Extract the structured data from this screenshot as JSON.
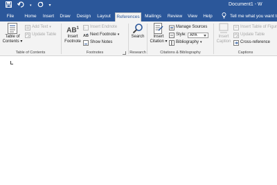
{
  "qat": {
    "save_icon": "save-icon",
    "undo_icon": "undo-icon",
    "redo_icon": "redo-icon",
    "customize_icon": "customize-qat-icon"
  },
  "title": "Document1 - W",
  "tabs": [
    "File",
    "Home",
    "Insert",
    "Draw",
    "Design",
    "Layout",
    "References",
    "Mailings",
    "Review",
    "View",
    "Help"
  ],
  "active_tab": "References",
  "tell_me": "Tell me what you want to do",
  "ribbon": {
    "toc": {
      "big_label_1": "Table of",
      "big_label_2": "Contents",
      "add_text": "Add Text",
      "update_table": "Update Table",
      "group_label": "Table of Contents"
    },
    "footnotes": {
      "big_label_1": "Insert",
      "big_label_2": "Footnote",
      "big_icon_text": "AB",
      "big_icon_sup": "1",
      "insert_endnote": "Insert Endnote",
      "next_footnote": "Next Footnote",
      "show_notes": "Show Notes",
      "group_label": "Footnotes"
    },
    "research": {
      "big_label": "Search",
      "group_label": "Research"
    },
    "citations": {
      "big_label_1": "Insert",
      "big_label_2": "Citation",
      "manage_sources": "Manage Sources",
      "style_label": "Style:",
      "style_value": "APA",
      "bibliography": "Bibliography",
      "group_label": "Citations & Bibliography"
    },
    "captions": {
      "big_label_1": "Insert",
      "big_label_2": "Caption",
      "insert_table_of_figures": "Insert Table of Figures",
      "update_table": "Update Table",
      "cross_reference": "Cross-reference",
      "group_label": "Captions"
    }
  },
  "colors": {
    "title_bar": "#2b579a",
    "ribbon_bg": "#f3f3f3",
    "active_tab_text": "#2b579a",
    "disabled_text": "#a8a8a8"
  }
}
